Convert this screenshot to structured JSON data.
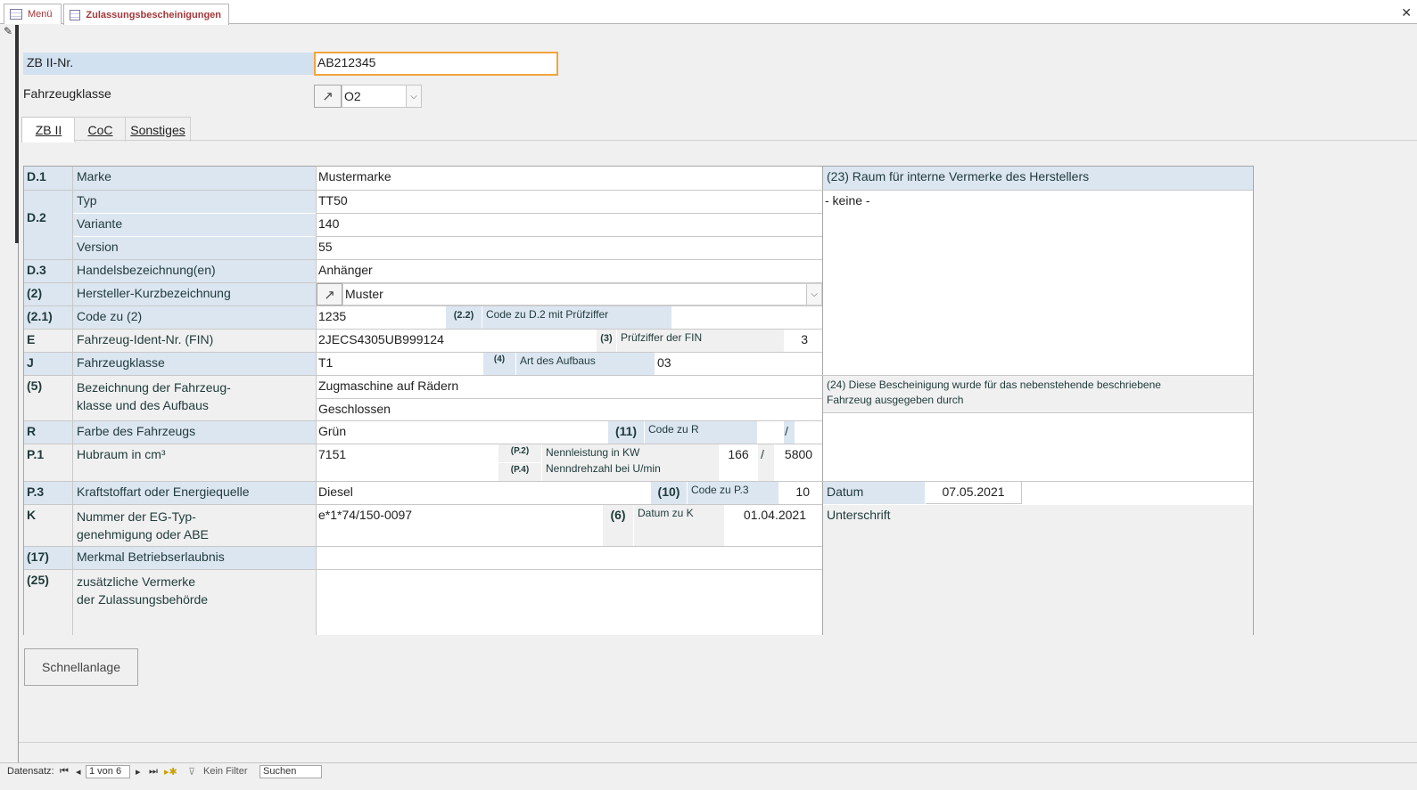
{
  "tabs": [
    {
      "label": "Menü"
    },
    {
      "label": "Zulassungsbescheinigungen"
    }
  ],
  "header": {
    "zb2_label": "ZB II-Nr.",
    "zb2_value": "AB212345",
    "fzkl_label": "Fahrzeugklasse",
    "fzkl_value": "O2"
  },
  "inner_tabs": [
    {
      "label": "ZB II"
    },
    {
      "label": "CoC"
    },
    {
      "label": "Sonstiges"
    }
  ],
  "rows": {
    "d1": {
      "code": "D.1",
      "label": "Marke",
      "value": "Mustermarke"
    },
    "d2": {
      "code": "D.2",
      "typ_label": "Typ",
      "typ_value": "TT50",
      "variante_label": "Variante",
      "variante_value": "140",
      "version_label": "Version",
      "version_value": "55"
    },
    "d3": {
      "code": "D.3",
      "label": "Handelsbezeichnung(en)",
      "value": "Anhänger"
    },
    "r2": {
      "code": "(2)",
      "label": "Hersteller-Kurzbezeichnung",
      "value": "Muster"
    },
    "r21": {
      "code": "(2.1)",
      "label": "Code zu (2)",
      "value": "1235",
      "code22": "(2.2)",
      "label22": "Code zu D.2 mit Prüfziffer",
      "value22": ""
    },
    "e": {
      "code": "E",
      "label": "Fahrzeug-Ident-Nr. (FIN)",
      "value": "2JECS4305UB999124",
      "code3": "(3)",
      "label3": "Prüfziffer der FIN",
      "value3": "3"
    },
    "j": {
      "code": "J",
      "label": "Fahrzeugklasse",
      "value": "T1",
      "code4": "(4)",
      "label4": "Art des  Aufbaus",
      "value4": "03"
    },
    "r5": {
      "code": "(5)",
      "label_line1": "Bezeichnung der Fahrzeug-",
      "label_line2": "klasse und des Aufbaus",
      "value1": "Zugmaschine auf Rädern",
      "value2": "Geschlossen"
    },
    "r": {
      "code": "R",
      "label": "Farbe des Fahrzeugs",
      "value": "Grün",
      "code11": "(11)",
      "label11": "Code zu R",
      "value11a": "",
      "slash": "/",
      "value11b": ""
    },
    "p1": {
      "code": "P.1",
      "label": "Hubraum in cm³",
      "value": "7151",
      "code_p2": "(P.2)",
      "code_p4": "(P.4)",
      "label_p2": "Nennleistung in KW",
      "label_p4": "Nenndrehzahl bei U/min",
      "value_p2": "166",
      "slash": "/",
      "value_p4": "5800"
    },
    "p3": {
      "code": "P.3",
      "label": "Kraftstoffart oder Energiequelle",
      "value": "Diesel",
      "code10": "(10)",
      "label10": "Code  zu P.3",
      "value10": "10"
    },
    "k": {
      "code": "K",
      "label_line1": "Nummer der EG-Typ-",
      "label_line2": "genehmigung oder ABE",
      "value": "e*1*74/150-0097",
      "code6": "(6)",
      "label6": "Datum zu K",
      "value6": "01.04.2021"
    },
    "r17": {
      "code": "(17)",
      "label": "Merkmal Betriebserlaubnis",
      "value": ""
    },
    "r25": {
      "code": "(25)",
      "label_line1": "zusätzliche Vermerke",
      "label_line2": "der Zulassungsbehörde",
      "value": ""
    }
  },
  "right": {
    "r23_label": "(23) Raum für interne Vermerke des Herstellers",
    "r23_value": "- keine -",
    "r24_line1": "(24) Diese Bescheinigung wurde für das nebenstehende beschriebene",
    "r24_line2": "Fahrzeug ausgegeben durch",
    "datum_label": "Datum",
    "datum_value": "07.05.2021",
    "unterschrift_label": "Unterschrift"
  },
  "quick_button": "Schnellanlage",
  "navbar": {
    "record_label": "Datensatz:",
    "record_value": "1 von 6",
    "filter_label": "Kein Filter",
    "search_label": "Suchen"
  },
  "colors": {
    "label_bg": "#dce6f1",
    "accent_tab": "#a4373a",
    "focus_border": "#f3a43d"
  }
}
